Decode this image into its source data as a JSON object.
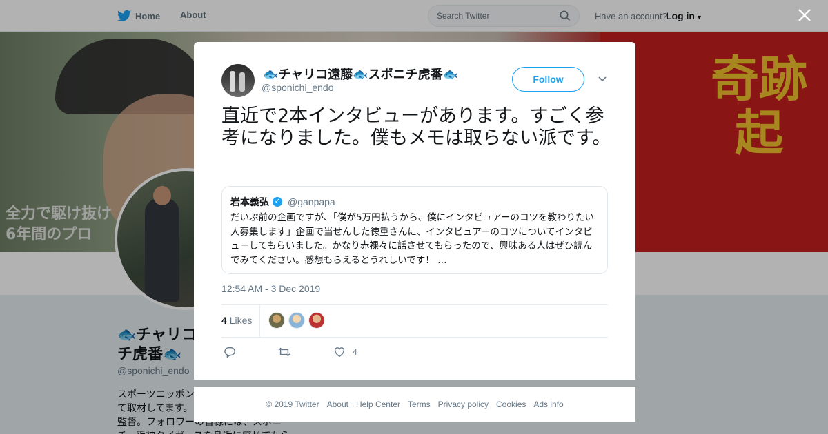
{
  "topbar": {
    "home_label": "Home",
    "about_label": "About",
    "search_placeholder": "Search Twitter",
    "have_account": "Have an account?",
    "login_label": "Log in"
  },
  "banner": {
    "kanji": "奇跡起",
    "small_text_1": "全力で駆け抜け",
    "small_text_2": "6年間のプロ"
  },
  "profile": {
    "name_line1": "🐟チャリコ",
    "name_line2": "チ虎番🐟",
    "handle": "@sponichi_endo",
    "bio_lines": [
      "スポーツニッポン",
      "て取材してます。",
      "監督。フォロワーの皆様には、スポニ",
      "チ。阪神タイガースを身近に感じてもら"
    ]
  },
  "tweet": {
    "author_name": "🐟チャリコ遠藤🐟スポニチ虎番🐟",
    "author_handle": "@sponichi_endo",
    "follow_label": "Follow",
    "text": "直近で2本インタビューがあります。すごく参考になりました。僕もメモは取らない派です。",
    "quote": {
      "name": "岩本義弘",
      "handle": "@ganpapa",
      "text": "だいぶ前の企画ですが、「僕が5万円払うから、僕にインタビュアーのコツを教わりたい人募集します」企画で当せんした徳重さんに、インタビュアーのコツについてインタビューしてもらいました。かなり赤裸々に話させてもらったので、興味ある人はぜひ読んでみてください。感想もらえるとうれしいです！ …"
    },
    "timestamp": "12:54 AM - 3 Dec 2019",
    "likes_count": "4",
    "likes_label": "Likes",
    "heart_count": "4"
  },
  "footer": {
    "links": [
      "© 2019 Twitter",
      "About",
      "Help Center",
      "Terms",
      "Privacy policy",
      "Cookies",
      "Ads info"
    ]
  },
  "icons": {
    "close": "close-icon",
    "twitter_logo": "bird-icon",
    "search": "search-icon",
    "reply": "reply-icon",
    "retweet": "retweet-icon",
    "like": "heart-icon",
    "caret": "chevron-down-icon"
  },
  "colors": {
    "brand_blue": "#1da1f2",
    "text_secondary": "#657786",
    "banner_red": "#c61f1f",
    "banner_yellow": "#f1c230"
  }
}
